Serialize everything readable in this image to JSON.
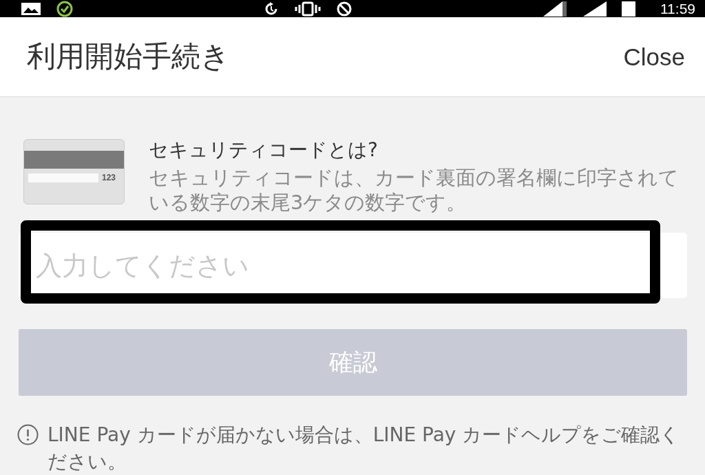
{
  "status_bar": {
    "time": "11:59"
  },
  "header": {
    "title": "利用開始手続き",
    "close": "Close"
  },
  "security_info": {
    "card_number": "123",
    "title": "セキュリティコードとは?",
    "description": "セキュリティコードは、カード裏面の署名欄に印字されている数字の末尾3ケタの数字です。"
  },
  "code_input": {
    "placeholder": "入力してください",
    "highlighted": true
  },
  "confirm_button": {
    "label": "確認",
    "disabled": true
  },
  "notice": {
    "text": "LINE Pay カードが届かない場合は、LINE Pay カードヘルプをご確認ください。"
  }
}
